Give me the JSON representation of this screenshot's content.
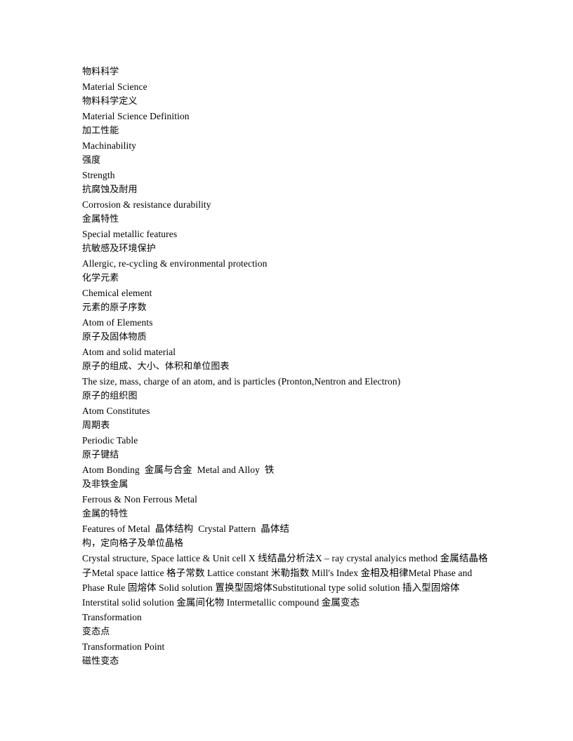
{
  "document": {
    "background_color": "#ffffff",
    "text_color": "#000000",
    "lines": [
      {
        "id": "l1",
        "text": "物料科学",
        "script": "cjk"
      },
      {
        "id": "l2",
        "text": "Material Science",
        "script": "latin"
      },
      {
        "id": "l3",
        "text": "物料科学定义",
        "script": "cjk"
      },
      {
        "id": "l4",
        "text": "Material Science Definition",
        "script": "latin"
      },
      {
        "id": "l5",
        "text": "加工性能",
        "script": "cjk"
      },
      {
        "id": "l6",
        "text": "Machinability",
        "script": "latin"
      },
      {
        "id": "l7",
        "text": "强度",
        "script": "cjk"
      },
      {
        "id": "l8",
        "text": "Strength",
        "script": "latin"
      },
      {
        "id": "l9",
        "text": "抗腐蚀及耐用",
        "script": "cjk"
      },
      {
        "id": "l10",
        "text": "Corrosion & resistance durability",
        "script": "latin"
      },
      {
        "id": "l11",
        "text": "金属特性",
        "script": "cjk"
      },
      {
        "id": "l12",
        "text": "Special metallic features",
        "script": "latin"
      },
      {
        "id": "l13",
        "text": "抗敏感及环境保护",
        "script": "cjk"
      },
      {
        "id": "l14",
        "text": "Allergic, re-cycling & environmental protection",
        "script": "latin"
      },
      {
        "id": "l15",
        "text": "化学元素",
        "script": "cjk"
      },
      {
        "id": "l16",
        "text": "Chemical element",
        "script": "latin"
      },
      {
        "id": "l17",
        "text": "元素的原子序数",
        "script": "cjk"
      },
      {
        "id": "l18",
        "text": "Atom of Elements",
        "script": "latin"
      },
      {
        "id": "l19",
        "text": "原子及固体物质",
        "script": "cjk"
      },
      {
        "id": "l20",
        "text": "Atom and solid material",
        "script": "latin"
      },
      {
        "id": "l21",
        "text": "原子的组成、大小、体积和单位图表",
        "script": "cjk"
      },
      {
        "id": "l22",
        "text": "The size, mass, charge of an atom, and is particles (Pronton,Nentron and Electron)",
        "script": "latin"
      },
      {
        "id": "l23",
        "text": "原子的组织图",
        "script": "cjk"
      },
      {
        "id": "l24",
        "text": "Atom Constitutes",
        "script": "latin"
      },
      {
        "id": "l25",
        "text": "周期表",
        "script": "cjk"
      },
      {
        "id": "l26",
        "text": "Periodic Table",
        "script": "latin"
      },
      {
        "id": "l27",
        "text": "原子键结",
        "script": "cjk"
      },
      {
        "id": "l28",
        "text": "Atom Bonding  金属与合金  Metal and Alloy  铁",
        "script": "mixed"
      },
      {
        "id": "l29",
        "text": "及非铁金属",
        "script": "cjk"
      },
      {
        "id": "l30",
        "text": "Ferrous & Non Ferrous Metal",
        "script": "latin"
      },
      {
        "id": "l31",
        "text": "金属的特性",
        "script": "cjk"
      },
      {
        "id": "l32",
        "text": "Features of Metal  晶体结构  Crystal Pattern  晶体结",
        "script": "mixed"
      },
      {
        "id": "l33",
        "text": "构，定向格子及单位晶格",
        "script": "cjk"
      }
    ],
    "flow_paragraph": {
      "id": "p1",
      "text": "Crystal structure, Space lattice & Unit cell X  线结晶分析法X – ray crystal analyics method  金属结晶格子Metal space lattice  格子常数  Lattice constant  米勒指数  Mill's Index  金相及相律Metal Phase and Phase Rule  固熔体  Solid solution  置换型固熔体Substitutional type solid solution  插入型固熔体  Interstital solid solution  金属间化物  Intermetallic compound    金属变态",
      "script": "mixed"
    },
    "trailing_lines": [
      {
        "id": "l34",
        "text": "Transformation",
        "script": "latin"
      },
      {
        "id": "l35",
        "text": "变态点",
        "script": "cjk"
      },
      {
        "id": "l36",
        "text": "Transformation Point",
        "script": "latin"
      },
      {
        "id": "l37",
        "text": "磁性变态",
        "script": "cjk"
      }
    ]
  }
}
